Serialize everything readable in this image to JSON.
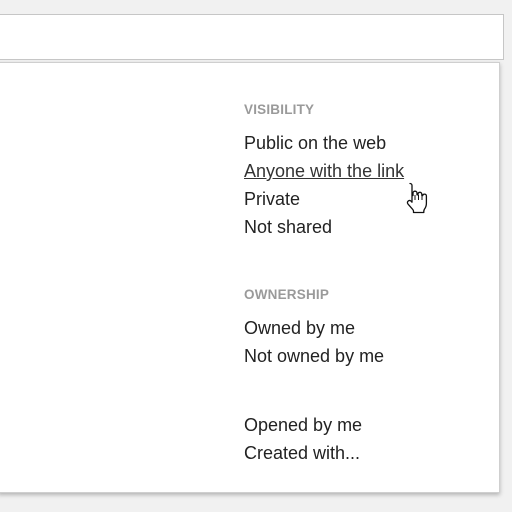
{
  "filters": {
    "visibility": {
      "heading": "VISIBILITY",
      "items": [
        "Public on the web",
        "Anyone with the link",
        "Private",
        "Not shared"
      ]
    },
    "ownership": {
      "heading": "OWNERSHIP",
      "items": [
        "Owned by me",
        "Not owned by me"
      ]
    },
    "other": {
      "items": [
        "Opened by me",
        "Created with..."
      ]
    }
  },
  "cursor": {
    "icon": "hand-pointer-icon"
  },
  "colors": {
    "heading": "#9a9a9a",
    "item_text": "#222222",
    "panel_bg": "#ffffff",
    "page_bg": "#f1f1f1"
  }
}
